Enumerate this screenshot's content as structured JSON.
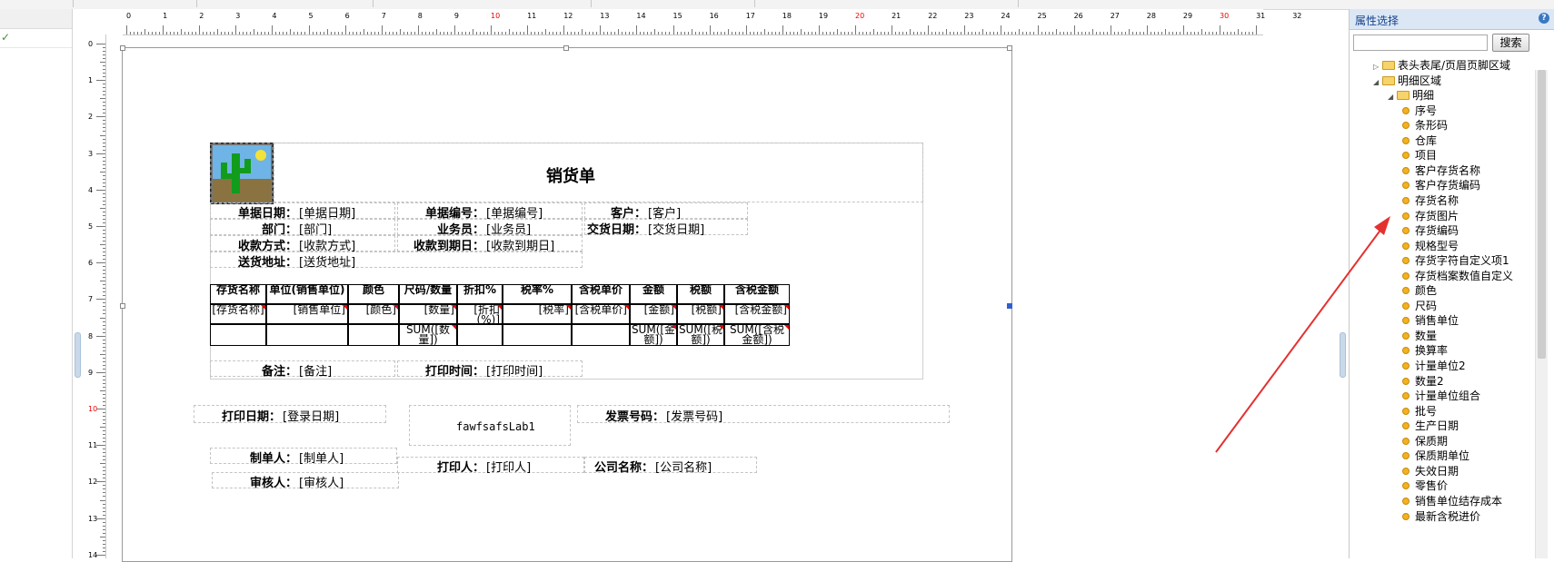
{
  "right_panel": {
    "title": "属性选择",
    "help_icon": "help-icon",
    "search_placeholder": "",
    "search_button": "搜索",
    "tree": [
      {
        "label": "表头表尾/页眉页脚区域",
        "level": 1,
        "expanded": false,
        "type": "folder"
      },
      {
        "label": "明细区域",
        "level": 1,
        "expanded": true,
        "type": "folder"
      },
      {
        "label": "明细",
        "level": 2,
        "expanded": true,
        "type": "folder"
      },
      {
        "label": "序号",
        "level": 3,
        "type": "leaf"
      },
      {
        "label": "条形码",
        "level": 3,
        "type": "leaf"
      },
      {
        "label": "仓库",
        "level": 3,
        "type": "leaf"
      },
      {
        "label": "项目",
        "level": 3,
        "type": "leaf"
      },
      {
        "label": "客户存货名称",
        "level": 3,
        "type": "leaf"
      },
      {
        "label": "客户存货编码",
        "level": 3,
        "type": "leaf"
      },
      {
        "label": "存货名称",
        "level": 3,
        "type": "leaf"
      },
      {
        "label": "存货图片",
        "level": 3,
        "type": "leaf"
      },
      {
        "label": "存货编码",
        "level": 3,
        "type": "leaf"
      },
      {
        "label": "规格型号",
        "level": 3,
        "type": "leaf"
      },
      {
        "label": "存货字符自定义项1",
        "level": 3,
        "type": "leaf"
      },
      {
        "label": "存货档案数值自定义",
        "level": 3,
        "type": "leaf"
      },
      {
        "label": "颜色",
        "level": 3,
        "type": "leaf"
      },
      {
        "label": "尺码",
        "level": 3,
        "type": "leaf"
      },
      {
        "label": "销售单位",
        "level": 3,
        "type": "leaf"
      },
      {
        "label": "数量",
        "level": 3,
        "type": "leaf"
      },
      {
        "label": "换算率",
        "level": 3,
        "type": "leaf"
      },
      {
        "label": "计量单位2",
        "level": 3,
        "type": "leaf"
      },
      {
        "label": "数量2",
        "level": 3,
        "type": "leaf"
      },
      {
        "label": "计量单位组合",
        "level": 3,
        "type": "leaf"
      },
      {
        "label": "批号",
        "level": 3,
        "type": "leaf"
      },
      {
        "label": "生产日期",
        "level": 3,
        "type": "leaf"
      },
      {
        "label": "保质期",
        "level": 3,
        "type": "leaf"
      },
      {
        "label": "保质期单位",
        "level": 3,
        "type": "leaf"
      },
      {
        "label": "失效日期",
        "level": 3,
        "type": "leaf"
      },
      {
        "label": "零售价",
        "level": 3,
        "type": "leaf"
      },
      {
        "label": "销售单位结存成本",
        "level": 3,
        "type": "leaf"
      },
      {
        "label": "最新含税进价",
        "level": 3,
        "type": "leaf"
      }
    ]
  },
  "ruler": {
    "h_numbers": [
      "0",
      "1",
      "2",
      "3",
      "4",
      "5",
      "6",
      "7",
      "8",
      "9",
      "10",
      "11",
      "12",
      "13",
      "14",
      "15",
      "16",
      "17",
      "18",
      "19",
      "20",
      "21",
      "22",
      "23",
      "24",
      "25",
      "26",
      "27",
      "28",
      "29",
      "30",
      "31",
      "32"
    ],
    "v_numbers": [
      "0",
      "1",
      "2",
      "3",
      "4",
      "5",
      "6",
      "7",
      "8",
      "9",
      "10",
      "11",
      "12",
      "13",
      "14"
    ],
    "highlight_color": "#e00000"
  },
  "report": {
    "title": "销货单",
    "logo_icon": "cactus-image-icon",
    "header_fields": [
      {
        "label": "单据日期：",
        "value": "[单据日期]"
      },
      {
        "label": "单据编号：",
        "value": "[单据编号]"
      },
      {
        "label": "客户：",
        "value": "[客户]"
      },
      {
        "label": "部门：",
        "value": "[部门]"
      },
      {
        "label": "业务员：",
        "value": "[业务员]"
      },
      {
        "label": "交货日期：",
        "value": "[交货日期]"
      },
      {
        "label": "收款方式：",
        "value": "[收款方式]"
      },
      {
        "label": "收款到期日：",
        "value": "[收款到期日]"
      },
      {
        "label": "送货地址：",
        "value": "[送货地址]"
      }
    ],
    "table": {
      "headers": [
        "存货名称",
        "单位(销售单位)",
        "颜色",
        "尺码/数量",
        "折扣%",
        "税率%",
        "含税单价",
        "金额",
        "税额",
        "含税金额"
      ],
      "row1": [
        "[存货名称]",
        "[销售单位]",
        "[颜色]",
        "[数量]",
        "[折扣(%)]",
        "[税率]",
        "[含税单价]",
        "[金额]",
        "[税额]",
        "[含税金额]"
      ],
      "row2": [
        "",
        "",
        "",
        "SUM([数量])",
        "",
        "",
        "",
        "SUM([金额])",
        "SUM([税额])",
        "SUM([含税金额])"
      ]
    },
    "footer_fields": [
      {
        "label": "备注：",
        "value": "[备注]"
      },
      {
        "label": "打印时间：",
        "value": "[打印时间]"
      }
    ],
    "bottom_fields": [
      {
        "label": "打印日期：",
        "value": "[登录日期]"
      },
      {
        "label": "发票号码：",
        "value": "[发票号码]"
      },
      {
        "label": "制单人：",
        "value": "[制单人]"
      },
      {
        "label": "打印人：",
        "value": "[打印人]"
      },
      {
        "label": "公司名称：",
        "value": "[公司名称]"
      },
      {
        "label": "审核人：",
        "value": "[审核人]"
      }
    ],
    "lab_text": "fawfsafsLab1"
  },
  "annotation": {
    "arrow_color": "#e53030",
    "arrow_icon": "red-arrow-icon"
  }
}
